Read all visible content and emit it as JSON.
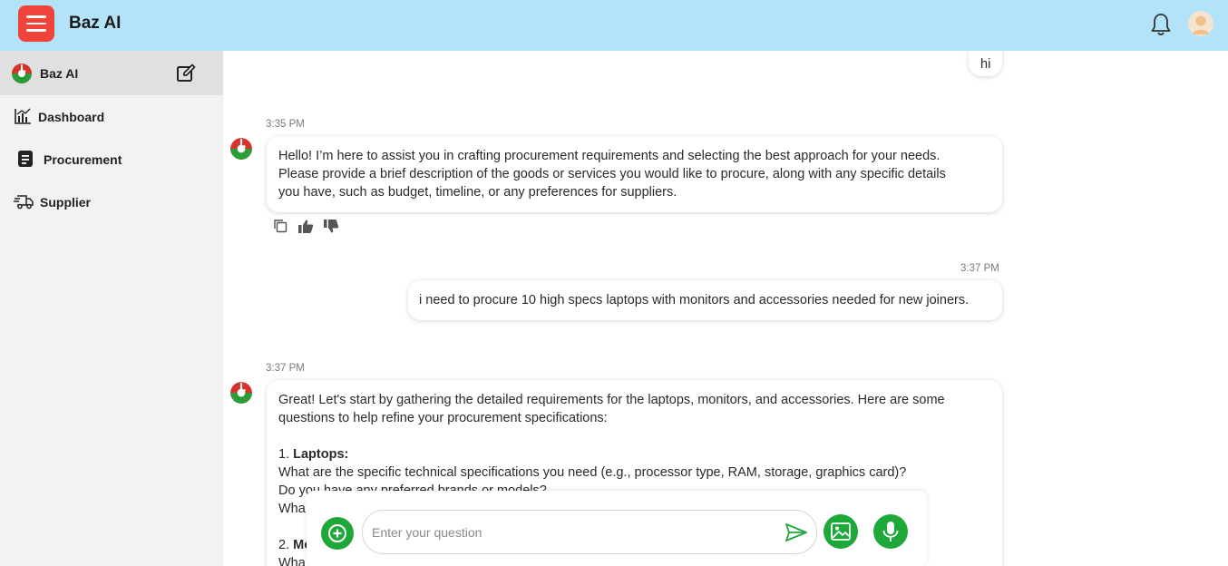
{
  "header": {
    "title": "Baz AI",
    "menu_icon": "hamburger-icon",
    "notification_icon": "bell-icon",
    "avatar_icon": "user-avatar",
    "brand_color": "#b3e3f8",
    "menu_color": "#f0443a"
  },
  "sidebar": {
    "top": {
      "label": "Baz AI",
      "logo_icon": "baz-logo-icon",
      "edit_icon": "new-chat-edit-icon"
    },
    "items": [
      {
        "label": "Dashboard",
        "icon": "chart-icon"
      },
      {
        "label": "Procurement",
        "icon": "document-icon"
      },
      {
        "label": "Supplier",
        "icon": "delivery-truck-icon"
      }
    ]
  },
  "chat": {
    "messages": [
      {
        "role": "user",
        "text": "hi"
      },
      {
        "role": "bot",
        "time": "3:35 PM",
        "lines": [
          "Hello! I’m here to assist you in crafting procurement requirements and selecting the best approach for your needs.",
          "Please provide a brief description of the goods or services you would like to procure, along with any specific details",
          "you have, such as budget, timeline, or any preferences for suppliers."
        ],
        "actions": [
          "copy-icon",
          "thumbs-up-icon",
          "thumbs-down-icon"
        ]
      },
      {
        "role": "user",
        "time": "3:37 PM",
        "text": "i need to procure 10 high specs laptops with monitors and accessories needed for new joiners."
      },
      {
        "role": "bot",
        "time": "3:37 PM",
        "lines": [
          "Great! Let's start by gathering the detailed requirements for the laptops, monitors, and accessories. Here are some",
          "questions to help refine your procurement specifications:",
          "1.",
          "Laptops:",
          "What are the specific technical specifications you need (e.g., processor type, RAM, storage, graphics card)?",
          "Do you have any preferred brands or models?",
          "Wha",
          "2.",
          "Mo",
          "Wha"
        ]
      }
    ]
  },
  "composer": {
    "placeholder": "Enter your question",
    "value": "",
    "add_icon": "plus-circle-icon",
    "send_icon": "send-icon",
    "image_icon": "image-upload-icon",
    "mic_icon": "microphone-icon",
    "accent": "#1fa83a"
  }
}
